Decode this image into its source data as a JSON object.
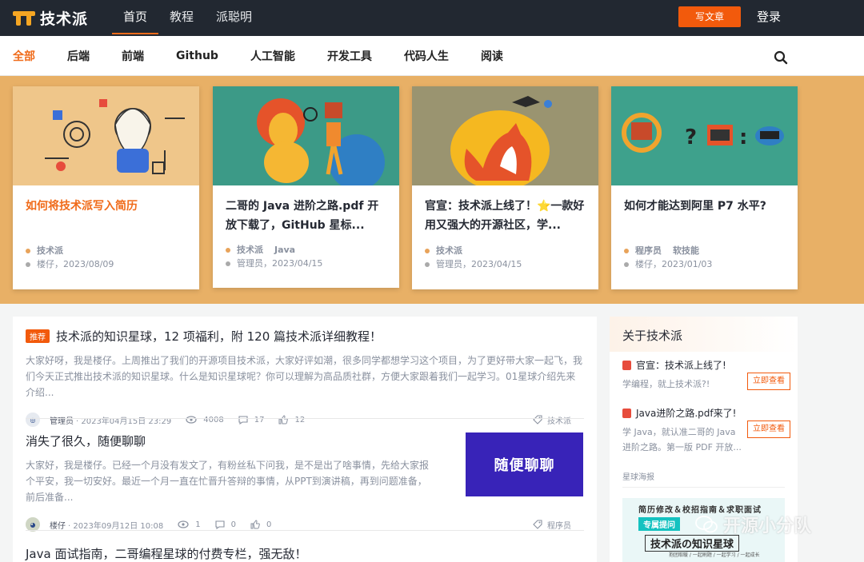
{
  "app": {
    "logo_text": "技术派"
  },
  "nav": {
    "items": [
      "首页",
      "教程",
      "派聪明"
    ],
    "write_button": "写文章",
    "login": "登录"
  },
  "categories": [
    "全部",
    "后端",
    "前端",
    "Github",
    "人工智能",
    "开发工具",
    "代码人生",
    "阅读"
  ],
  "featured": [
    {
      "title": "如何将技术派写入简历",
      "tags": [
        "技术派"
      ],
      "author": "楼仔",
      "date": "2023/08/09",
      "dot_color": "#e8a35a"
    },
    {
      "title": "二哥的 Java 进阶之路.pdf 开放下载了，GitHub 星标...",
      "tags": [
        "技术派",
        "Java"
      ],
      "author": "管理员",
      "date": "2023/04/15",
      "dot_color": "#e8a35a"
    },
    {
      "title": "官宣：技术派上线了！⭐一款好用又强大的开源社区，学...",
      "tags": [
        "技术派"
      ],
      "author": "管理员",
      "date": "2023/04/15",
      "dot_color": "#e8a35a"
    },
    {
      "title": "如何才能达到阿里 P7 水平?",
      "tags": [
        "程序员",
        "软技能"
      ],
      "author": "楼仔",
      "date": "2023/01/03",
      "dot_color": "#e8a35a"
    }
  ],
  "articles": [
    {
      "badge": "推荐",
      "title": "技术派的知识星球，12 项福利，附 120 篇技术派详细教程！",
      "summary": "大家好呀，我是楼仔。上周推出了我们的开源项目技术派，大家好评如潮，很多同学都想学习这个项目，为了更好带大家一起飞，我们今天正式推出技术派的知识星球。什么是知识星球呢？你可以理解为高品质社群，方便大家跟着我们一起学习。01星球介绍先来介绍...",
      "author": "管理员",
      "time": "· 2023年04月15日 23:29",
      "views": "4008",
      "comments": "17",
      "likes": "12",
      "tag": "技术派"
    },
    {
      "title": "消失了很久，随便聊聊",
      "summary": "大家好，我是楼仔。已经一个月没有发文了，有粉丝私下问我，是不是出了啥事情，先给大家报个平安，我一切安好。最近一个月一直在忙晋升答辩的事情，从PPT到演讲稿，再到问题准备，前后准备...",
      "author": "楼仔",
      "time": "· 2023年09月12日 10:08",
      "views": "1",
      "comments": "0",
      "likes": "0",
      "tag": "程序员",
      "thumb_text": "随便聊聊"
    },
    {
      "title": "Java 面试指南，二哥编程星球的付费专栏，强无敌！"
    }
  ],
  "sidebar": {
    "title": "关于技术派",
    "items": [
      {
        "title": "官宣：技术派上线了!",
        "desc": "学编程，就上技术派?!",
        "button": "立即查看"
      },
      {
        "title": "Java进阶之路.pdf来了!",
        "desc": "学 Java，就认准二哥的 Java 进阶之路。第一版 PDF 开放...",
        "button": "立即查看"
      }
    ],
    "section": "星球海报",
    "poster": {
      "line1": "简历修改＆校招指南＆求职面试",
      "tag": "专属提问",
      "title": "技术派の知识星球",
      "sub": "抱团取暖 / 一起刷题 / 一起学习 / 一起成长"
    }
  },
  "watermark": "开源小分队",
  "colors": {
    "accent": "#f25a0c",
    "banner": "#e8b066",
    "topbar": "#222831"
  }
}
